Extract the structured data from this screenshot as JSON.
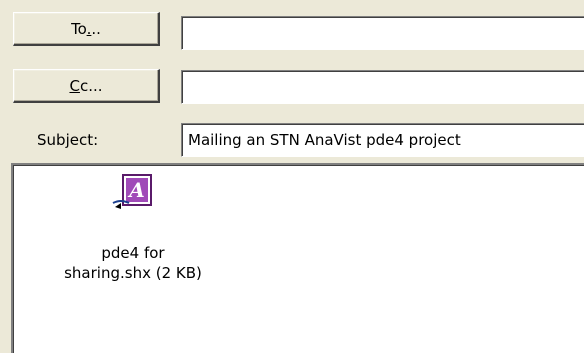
{
  "to_button": {
    "before": "To",
    "accel": ".",
    "after": ".."
  },
  "cc_button": {
    "accel": "C",
    "after": "c..."
  },
  "to_field": {
    "value": ""
  },
  "cc_field": {
    "value": ""
  },
  "subject": {
    "label_before": "Sub",
    "label_accel": "j",
    "label_after": "ect:",
    "value": "Mailing an STN AnaVist pde4 project"
  },
  "attachment": {
    "icon": "anavist-file-icon",
    "name_line1": "pde4 for",
    "name_line2": "sharing.shx (2 KB)",
    "accent": "#7b2a8c"
  }
}
